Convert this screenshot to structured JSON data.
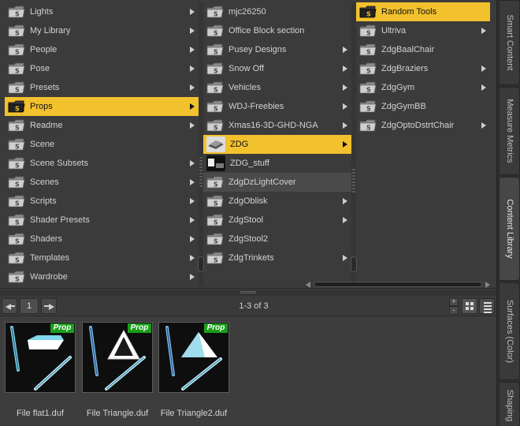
{
  "columns": {
    "col1": [
      {
        "label": "Lights",
        "arrow": true
      },
      {
        "label": "My Library",
        "arrow": true
      },
      {
        "label": "People",
        "arrow": true
      },
      {
        "label": "Pose",
        "arrow": true
      },
      {
        "label": "Presets",
        "arrow": true
      },
      {
        "label": "Props",
        "arrow": true,
        "selected": true
      },
      {
        "label": "Readme",
        "arrow": true
      },
      {
        "label": "Scene",
        "arrow": false
      },
      {
        "label": "Scene Subsets",
        "arrow": true
      },
      {
        "label": "Scenes",
        "arrow": true
      },
      {
        "label": "Scripts",
        "arrow": true
      },
      {
        "label": "Shader Presets",
        "arrow": true
      },
      {
        "label": "Shaders",
        "arrow": true
      },
      {
        "label": "Templates",
        "arrow": true
      },
      {
        "label": "Wardrobe",
        "arrow": true
      }
    ],
    "col2": [
      {
        "label": "mjc26250",
        "arrow": false
      },
      {
        "label": "Office Block section",
        "arrow": false
      },
      {
        "label": "Pusey Designs",
        "arrow": true
      },
      {
        "label": "Snow Off",
        "arrow": true
      },
      {
        "label": "Vehicles",
        "arrow": true
      },
      {
        "label": "WDJ-Freebies",
        "arrow": true
      },
      {
        "label": "Xmas16-3D-GHD-NGA",
        "arrow": true
      },
      {
        "label": "ZDG",
        "arrow": true,
        "selected": true,
        "thumb": "light"
      },
      {
        "label": "ZDG_stuff",
        "arrow": false,
        "thumb": "dark"
      },
      {
        "label": "ZdgDzLightCover",
        "arrow": false,
        "hover": true
      },
      {
        "label": "ZdgOblisk",
        "arrow": true
      },
      {
        "label": "ZdgStool",
        "arrow": true
      },
      {
        "label": "ZdgStool2",
        "arrow": false
      },
      {
        "label": "ZdgTrinkets",
        "arrow": true
      }
    ],
    "col3": [
      {
        "label": "Random Tools",
        "arrow": false,
        "selected": true
      },
      {
        "label": "Ultriva",
        "arrow": true
      },
      {
        "label": "ZdgBaalChair",
        "arrow": false
      },
      {
        "label": "ZdgBraziers",
        "arrow": true
      },
      {
        "label": "ZdgGym",
        "arrow": true
      },
      {
        "label": "ZdgGymBB",
        "arrow": false
      },
      {
        "label": "ZdgOptoDstrtChair",
        "arrow": true
      }
    ]
  },
  "navbar": {
    "page": "1",
    "page_count": "1-3 of 3",
    "zoom_in": "+",
    "zoom_out": "-"
  },
  "results": [
    {
      "name": "File flat1.duf",
      "badge": "Prop"
    },
    {
      "name": "File Triangle.duf",
      "badge": "Prop"
    },
    {
      "name": "File Triangle2.duf",
      "badge": "Prop"
    }
  ],
  "tabs": [
    {
      "label": "Smart Content",
      "active": false
    },
    {
      "label": "Measure Metrics",
      "active": false
    },
    {
      "label": "Content Library",
      "active": true
    },
    {
      "label": "Surfaces (Color)",
      "active": false
    },
    {
      "label": "Shaping",
      "active": false
    }
  ],
  "colors": {
    "selection": "#f2c12e",
    "badge": "#1a9e1a",
    "background": "#3d3d3d"
  }
}
